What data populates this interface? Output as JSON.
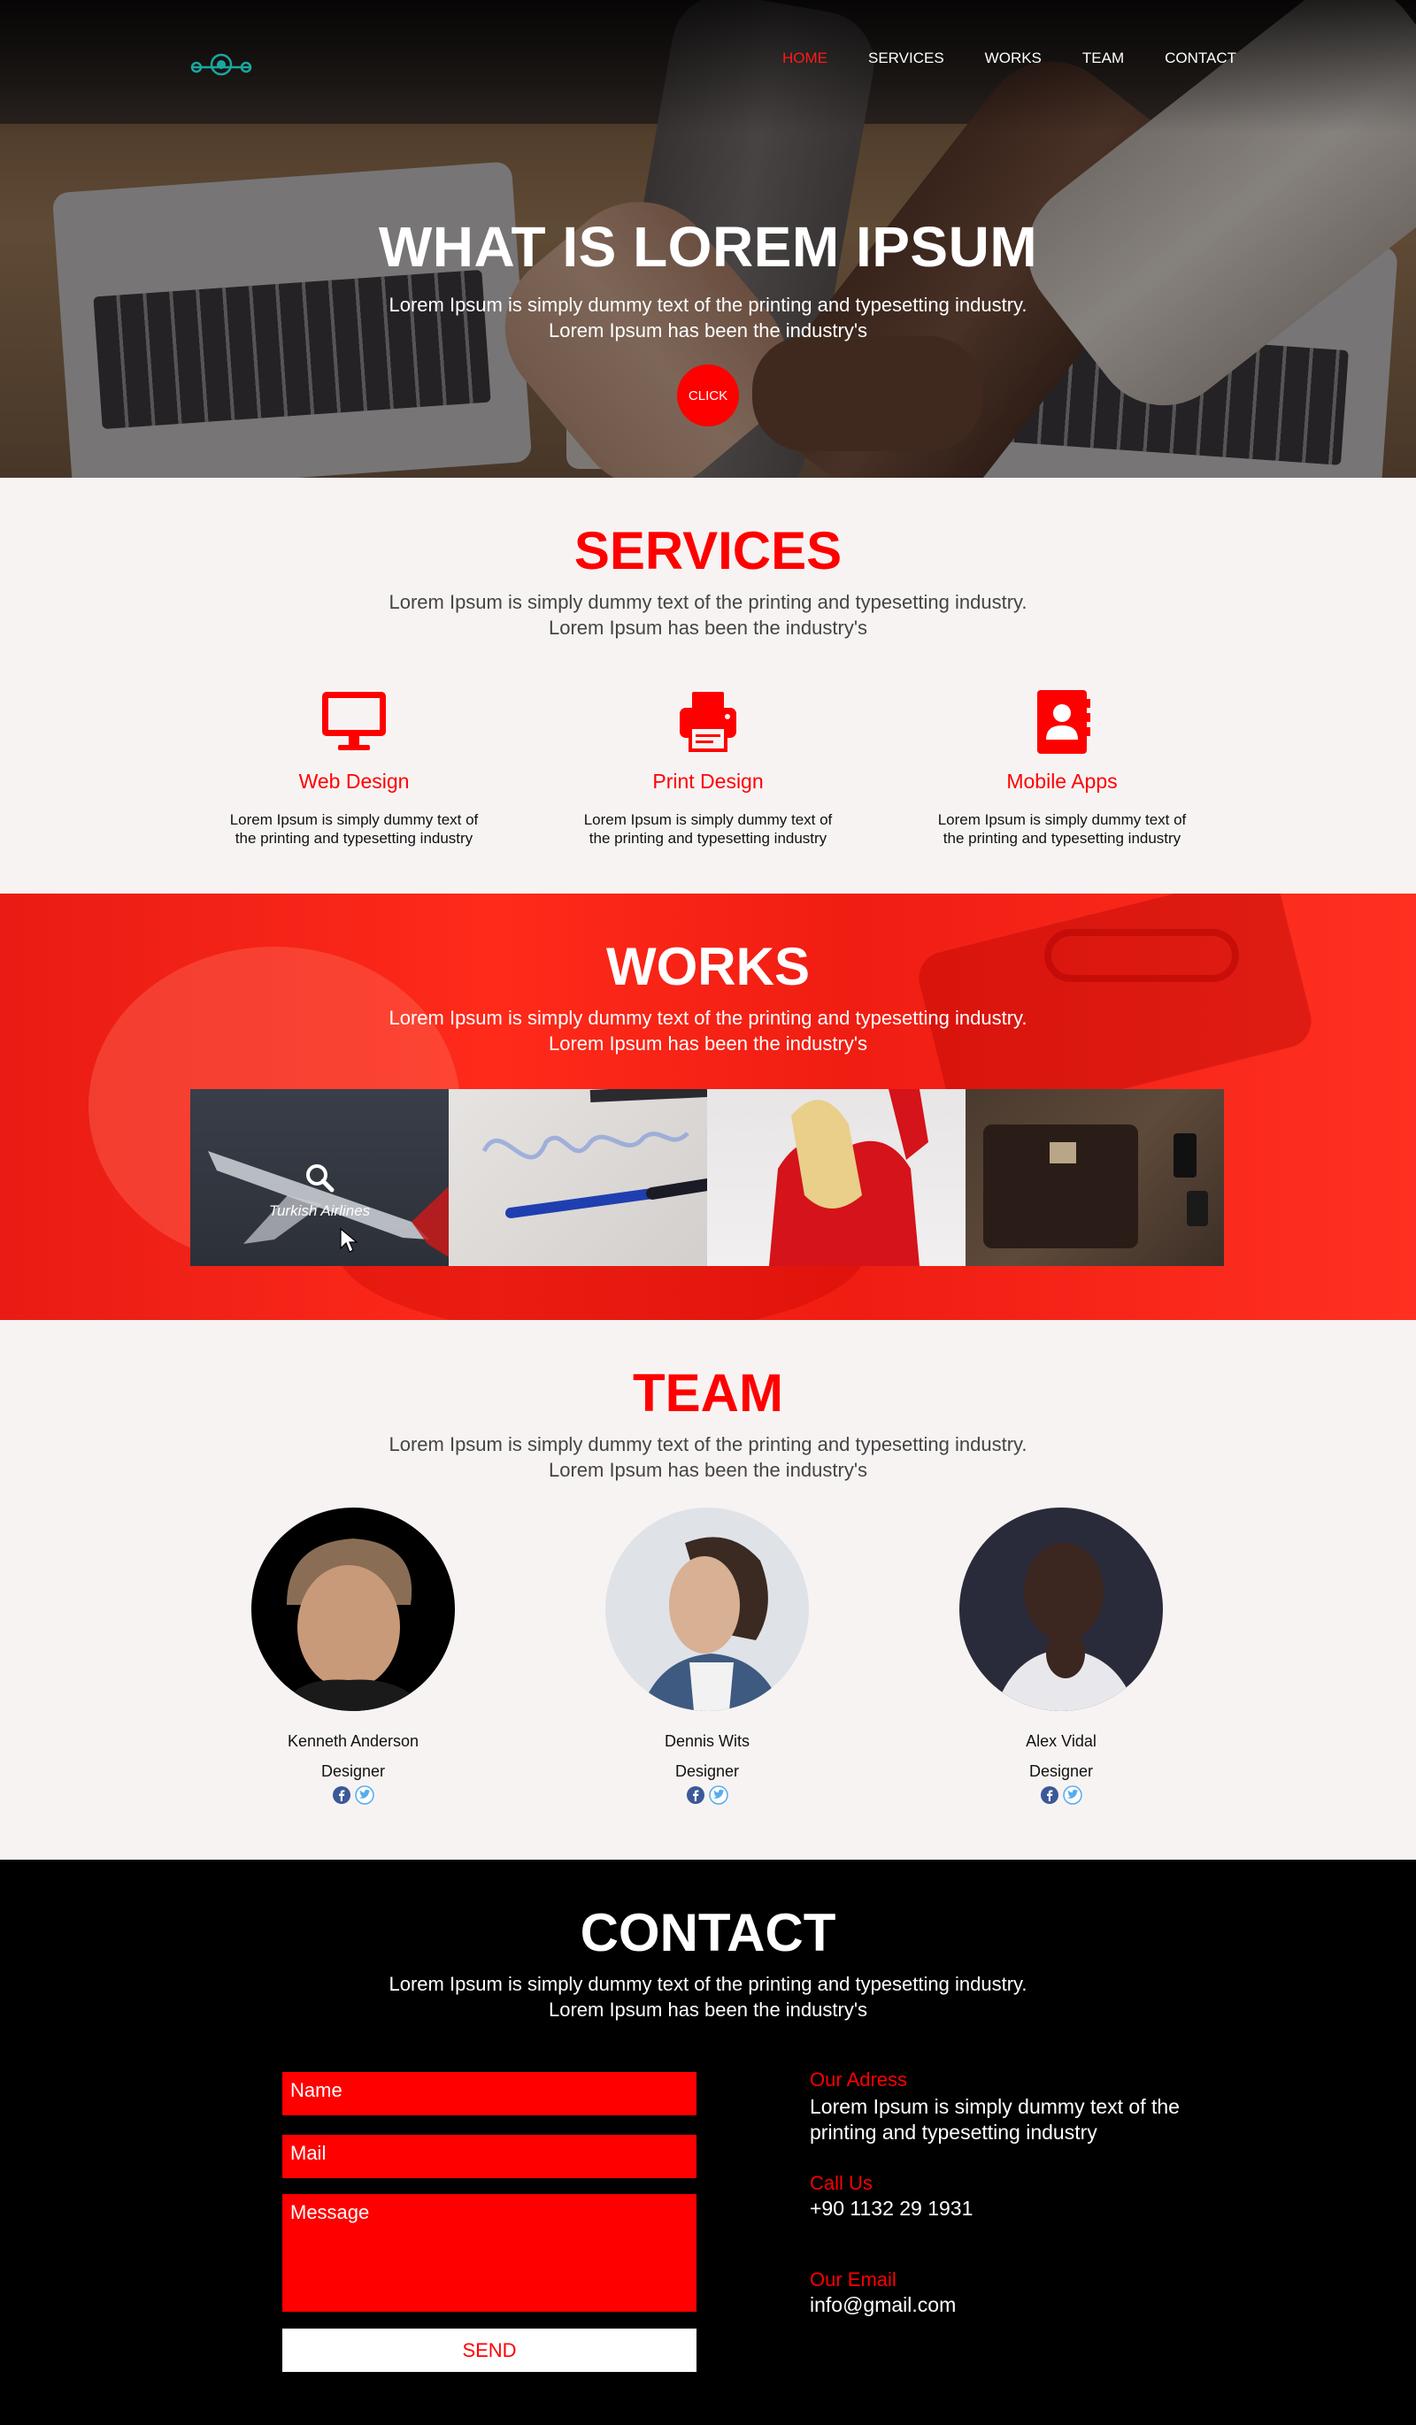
{
  "nav": {
    "items": [
      "HOME",
      "SERVICES",
      "WORKS",
      "TEAM",
      "CONTACT"
    ],
    "active": "HOME"
  },
  "hero": {
    "title": "WHAT IS LOREM IPSUM",
    "subtitle_line1": "Lorem Ipsum is simply dummy text of the printing and typesetting industry.",
    "subtitle_line2": "Lorem Ipsum has been the industry's",
    "button_label": "CLICK"
  },
  "services": {
    "title": "SERVICES",
    "subtitle_line1": "Lorem Ipsum is simply dummy text of the printing and typesetting industry.",
    "subtitle_line2": "Lorem Ipsum has been the industry's",
    "items": [
      {
        "icon": "desktop-icon",
        "name": "Web Design",
        "desc_line1": "Lorem Ipsum is simply dummy text of",
        "desc_line2": "the printing and typesetting industry"
      },
      {
        "icon": "printer-icon",
        "name": "Print Design",
        "desc_line1": "Lorem Ipsum is simply dummy text of",
        "desc_line2": "the printing and typesetting industry"
      },
      {
        "icon": "contact-book-icon",
        "name": "Mobile Apps",
        "desc_line1": "Lorem Ipsum is simply dummy text of",
        "desc_line2": "the printing and typesetting industry"
      }
    ]
  },
  "works": {
    "title": "WORKS",
    "subtitle_line1": "Lorem Ipsum is simply dummy text of the printing and typesetting industry.",
    "subtitle_line2": "Lorem Ipsum has been the industry's",
    "tiles": [
      {
        "caption": "Turkish Airlines",
        "icon": "search-icon"
      },
      {
        "caption": ""
      },
      {
        "caption": ""
      },
      {
        "caption": ""
      }
    ]
  },
  "team": {
    "title": "TEAM",
    "subtitle_line1": "Lorem Ipsum is simply dummy text of the printing and typesetting industry.",
    "subtitle_line2": "Lorem Ipsum has been the industry's",
    "members": [
      {
        "name": "Kenneth Anderson",
        "role": "Designer",
        "social": [
          "facebook-icon",
          "twitter-icon"
        ]
      },
      {
        "name": "Dennis Wits",
        "role": "Designer",
        "social": [
          "facebook-icon",
          "twitter-icon"
        ]
      },
      {
        "name": "Alex Vidal",
        "role": "Designer",
        "social": [
          "facebook-icon",
          "twitter-icon"
        ]
      }
    ]
  },
  "contact": {
    "title": "CONTACT",
    "subtitle_line1": "Lorem Ipsum is simply dummy text of the printing and typesetting industry.",
    "subtitle_line2": "Lorem Ipsum has been the industry's",
    "form": {
      "name_placeholder": "Name",
      "mail_placeholder": "Mail",
      "message_placeholder": "Message",
      "send_label": "SEND"
    },
    "address_label": "Our Adress",
    "address_line1": "Lorem Ipsum is simply dummy text of the",
    "address_line2": "printing and typesetting industry",
    "phone_label": "Call Us",
    "phone": "+90 1132 29 1931",
    "email_label": "Our Email",
    "email": "info@gmail.com"
  },
  "colors": {
    "accent": "#ff0000",
    "logo": "#1ba7a0",
    "background": "#f8f3f3",
    "contact_bg": "#000000",
    "facebook": "#3b5998",
    "twitter": "#55acee"
  }
}
